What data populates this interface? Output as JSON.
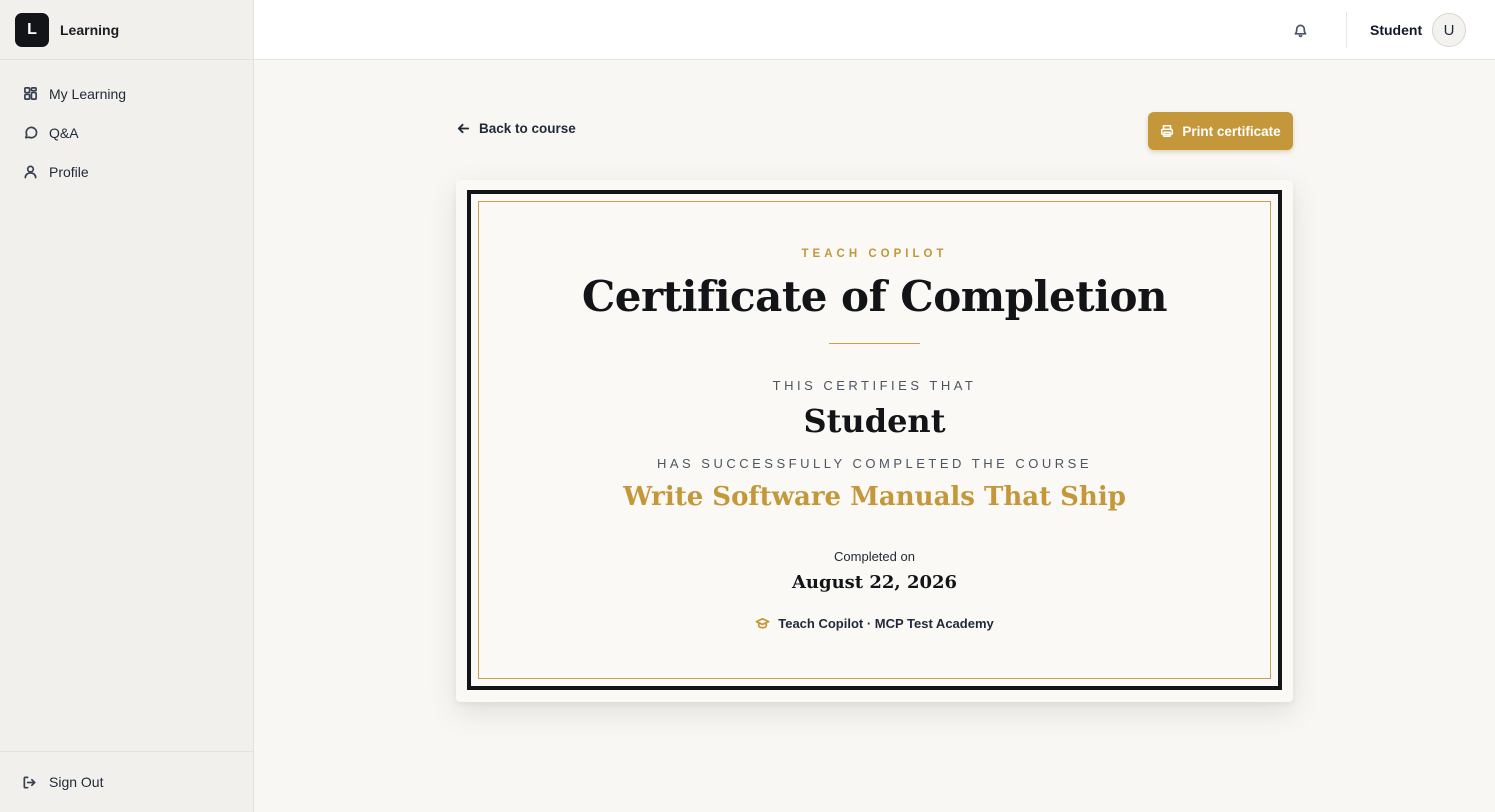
{
  "app": {
    "logo_letter": "L",
    "name": "Learning"
  },
  "sidebar": {
    "items": [
      {
        "label": "My Learning",
        "icon": "grid-icon"
      },
      {
        "label": "Q&A",
        "icon": "chat-bubble-icon"
      },
      {
        "label": "Profile",
        "icon": "user-icon"
      }
    ],
    "signout_label": "Sign Out"
  },
  "header": {
    "user_name": "Student",
    "avatar_initial": "U"
  },
  "page": {
    "back_label": "Back to course",
    "print_label": "Print certificate"
  },
  "certificate": {
    "issuer": "TEACH COPILOT",
    "title": "Certificate of Completion",
    "certifies_text": "THIS CERTIFIES THAT",
    "recipient": "Student",
    "completed_text": "HAS SUCCESSFULLY COMPLETED THE COURSE",
    "course_name": "Write Software Manuals That Ship",
    "completed_on_label": "Completed on",
    "completed_date": "August 22, 2026",
    "footer": "Teach Copilot · MCP Test Academy"
  },
  "colors": {
    "accent_gold": "#c4973a",
    "dark": "#121418",
    "background": "#f8f7f3"
  }
}
